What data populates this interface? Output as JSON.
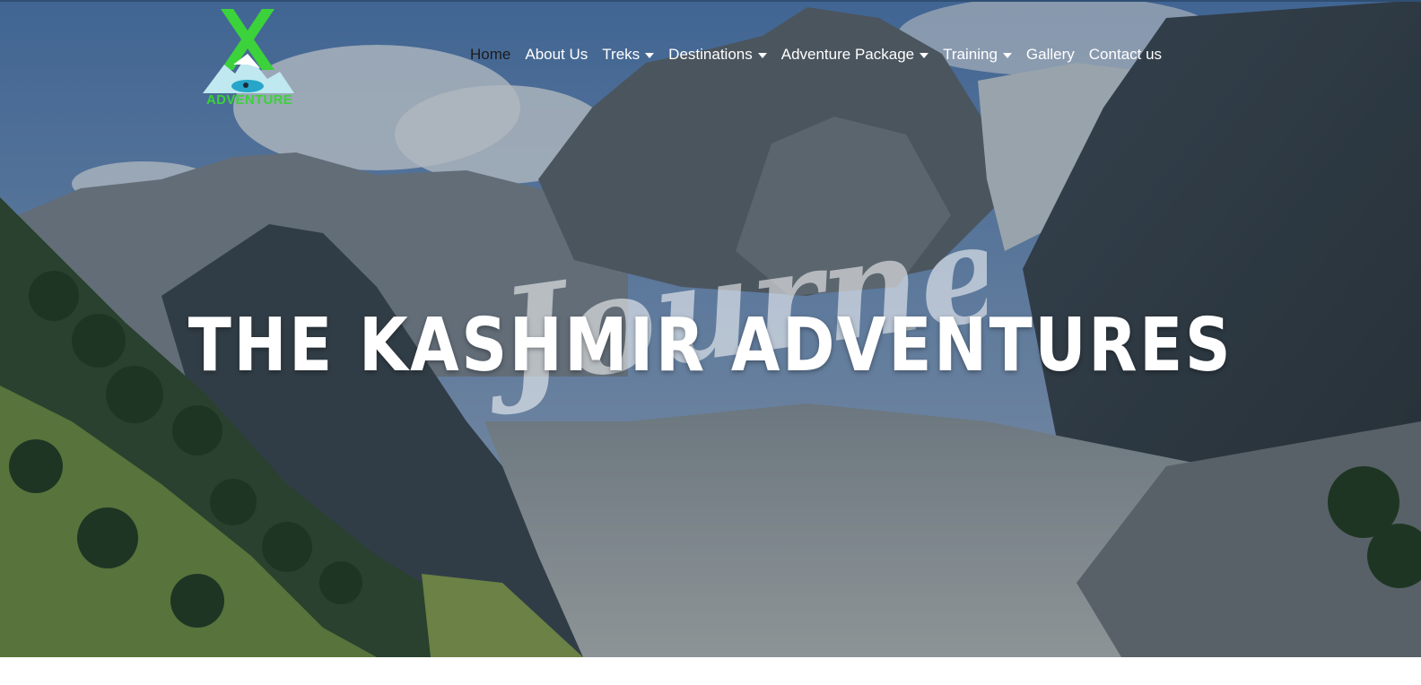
{
  "site": {
    "logo": {
      "mark": "X",
      "text": "ADVENTURE"
    },
    "nav": [
      {
        "label": "Home",
        "active": true,
        "dropdown": false,
        "icon": ""
      },
      {
        "label": "About Us",
        "active": false,
        "dropdown": false,
        "icon": ""
      },
      {
        "label": "Treks",
        "active": false,
        "dropdown": true,
        "icon": "caret-down-icon"
      },
      {
        "label": "Destinations",
        "active": false,
        "dropdown": true,
        "icon": "caret-down-icon"
      },
      {
        "label": "Adventure Package",
        "active": false,
        "dropdown": true,
        "icon": "caret-down-icon"
      },
      {
        "label": "Training",
        "active": false,
        "dropdown": true,
        "icon": "caret-down-icon"
      },
      {
        "label": "Gallery",
        "active": false,
        "dropdown": false,
        "icon": ""
      },
      {
        "label": "Contact us",
        "active": false,
        "dropdown": false,
        "icon": ""
      }
    ]
  },
  "hero": {
    "script_word": "Journey",
    "headline": "THE KASHMIR ADVENTURES",
    "background": "mountain-valley-photo"
  },
  "colors": {
    "logo_green": "#3bd23b",
    "nav_text": "#ffffff",
    "nav_active": "#1c1c1c",
    "headline": "#ffffff"
  }
}
